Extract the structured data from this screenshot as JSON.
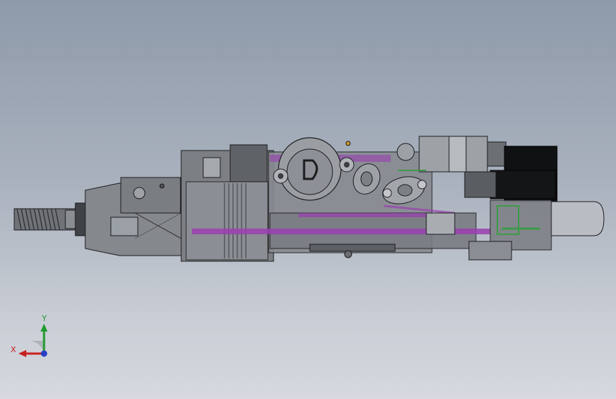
{
  "viewport": {
    "background_top": "#8e9aaa",
    "background_bottom": "#d6d9de"
  },
  "model": {
    "colors": {
      "body_gray": "#7c7f84",
      "light_gray": "#9ea2a7",
      "dark_gray": "#4d5054",
      "edge_black": "#1b1c1e",
      "purple": "#9a3fb0",
      "green": "#3e9a48",
      "motor_black": "#101112",
      "cylinder_gray": "#b9bdc3"
    }
  },
  "triad": {
    "y_label": "Y",
    "x_label": "X",
    "y_color": "#1e9a2e",
    "x_color": "#c82020",
    "z_color": "#2b3fc4"
  }
}
